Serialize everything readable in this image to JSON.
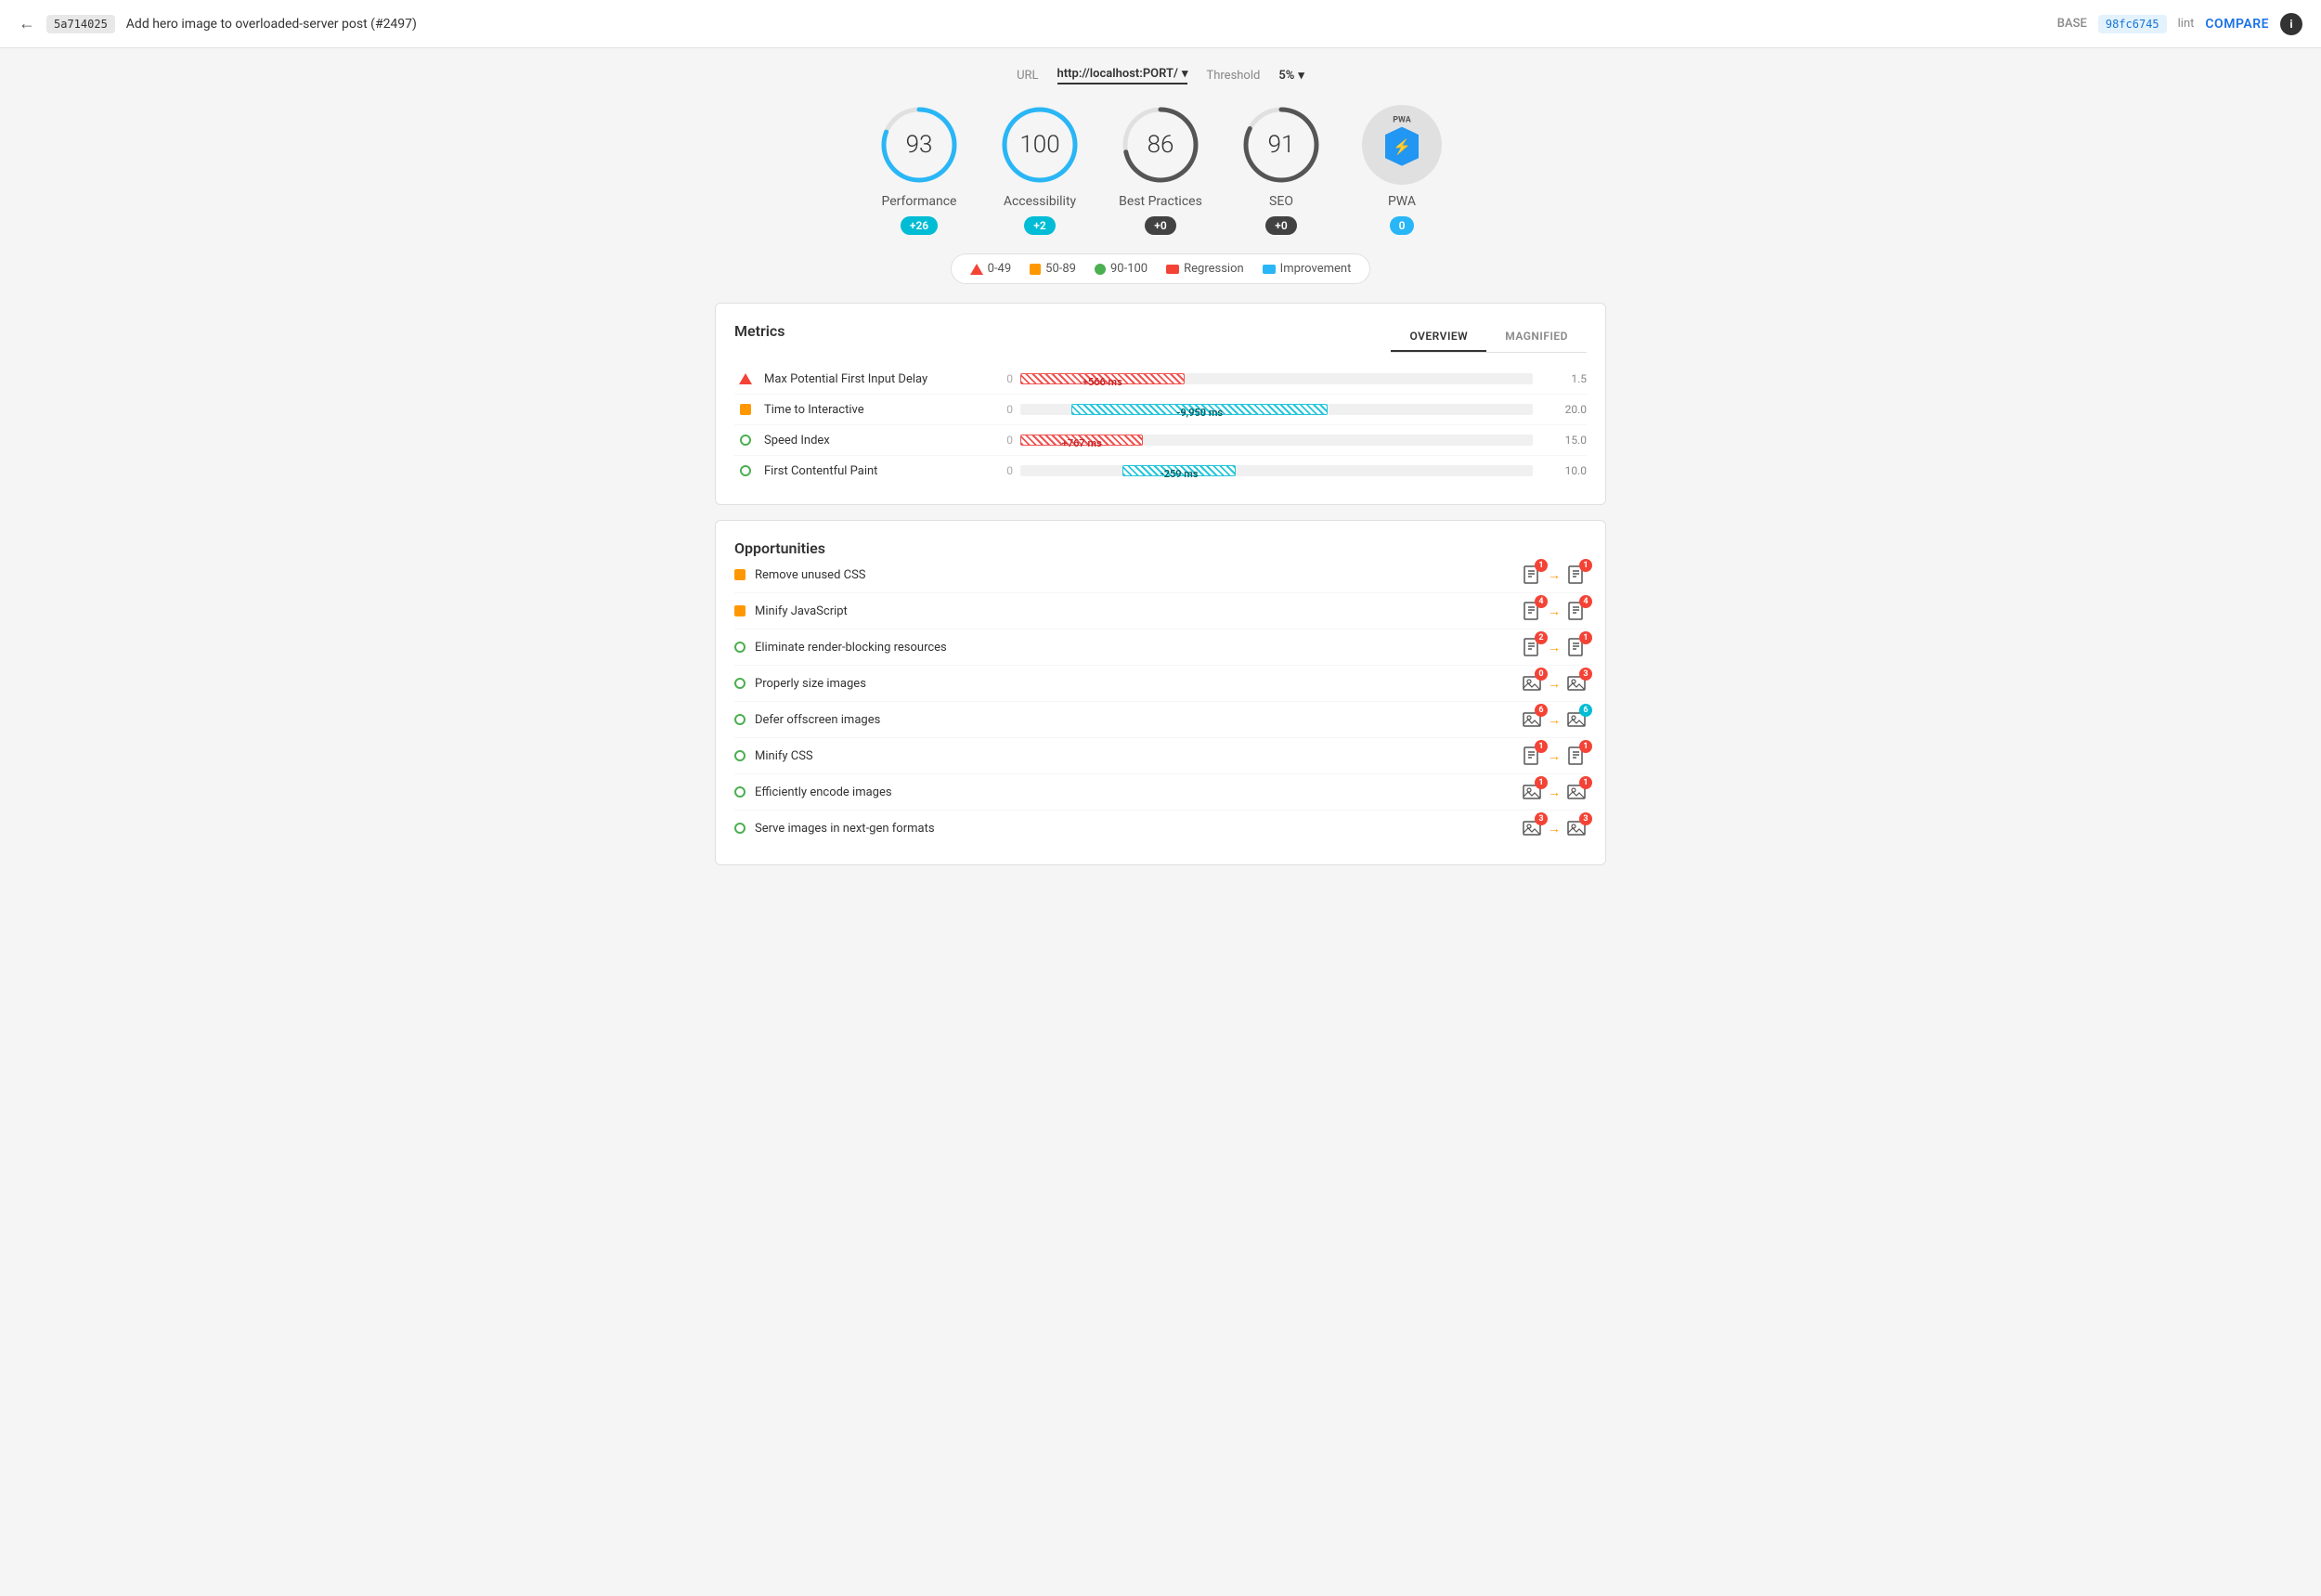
{
  "header": {
    "back_label": "←",
    "commit_base": "5a714025",
    "commit_title": "Add hero image to overloaded-server post (#2497)",
    "base_label": "BASE",
    "commit_compare": "98fc6745",
    "lint_label": "lint",
    "compare_label": "COMPARE",
    "info_label": "i"
  },
  "url_bar": {
    "url_label": "URL",
    "url_value": "http://localhost:PORT/",
    "threshold_label": "Threshold",
    "threshold_value": "5%"
  },
  "scores": [
    {
      "id": "performance",
      "value": "93",
      "label": "Performance",
      "badge": "+26",
      "badge_type": "teal",
      "color": "#29b6f6",
      "track_color": "#333"
    },
    {
      "id": "accessibility",
      "value": "100",
      "label": "Accessibility",
      "badge": "+2",
      "badge_type": "teal",
      "color": "#29b6f6",
      "track_color": "#333"
    },
    {
      "id": "best-practices",
      "value": "86",
      "label": "Best Practices",
      "badge": "+0",
      "badge_type": "dark",
      "color": "#333",
      "track_color": "#333"
    },
    {
      "id": "seo",
      "value": "91",
      "label": "SEO",
      "badge": "+0",
      "badge_type": "dark",
      "color": "#333",
      "track_color": "#333"
    },
    {
      "id": "pwa",
      "value": "PWA",
      "label": "PWA",
      "badge": "0",
      "badge_type": "blue",
      "is_pwa": true
    }
  ],
  "legend": [
    {
      "type": "triangle",
      "label": "0-49"
    },
    {
      "type": "square",
      "label": "50-89"
    },
    {
      "type": "circle",
      "label": "90-100"
    },
    {
      "type": "rect-red",
      "label": "Regression"
    },
    {
      "type": "rect-blue",
      "label": "Improvement"
    }
  ],
  "metrics": {
    "title": "Metrics",
    "tabs": [
      "OVERVIEW",
      "MAGNIFIED"
    ],
    "active_tab": 0,
    "rows": [
      {
        "icon": "triangle",
        "name": "Max Potential First Input Delay",
        "zero": "0",
        "bar_type": "positive-red",
        "bar_width_pct": 30,
        "bar_label": "+566 ms",
        "score": "1.5"
      },
      {
        "icon": "square",
        "name": "Time to Interactive",
        "zero": "0",
        "bar_type": "negative-teal",
        "bar_width_pct": 45,
        "bar_offset_pct": 15,
        "bar_label": "-9,950 ms",
        "score": "20.0"
      },
      {
        "icon": "circle-green",
        "name": "Speed Index",
        "zero": "0",
        "bar_type": "positive-red",
        "bar_width_pct": 20,
        "bar_label": "+767 ms",
        "score": "15.0"
      },
      {
        "icon": "circle-green",
        "name": "First Contentful Paint",
        "zero": "0",
        "bar_type": "negative-teal",
        "bar_width_pct": 18,
        "bar_offset_pct": 18,
        "bar_label": "-259 ms",
        "score": "10.0"
      }
    ]
  },
  "opportunities": {
    "title": "Opportunities",
    "rows": [
      {
        "icon": "square",
        "name": "Remove unused CSS",
        "base_badge": "1",
        "arrow": "→",
        "compare_badge": "1",
        "compare_color": "red"
      },
      {
        "icon": "square",
        "name": "Minify JavaScript",
        "base_badge": "4",
        "arrow": "→",
        "compare_badge": "4",
        "compare_color": "red"
      },
      {
        "icon": "circle-green",
        "name": "Eliminate render-blocking resources",
        "base_badge": "2",
        "arrow": "→",
        "compare_badge": "1",
        "compare_color": "red"
      },
      {
        "icon": "circle-green",
        "name": "Properly size images",
        "base_badge": "0",
        "arrow": "→",
        "compare_badge": "3",
        "compare_color": "red",
        "img_icon": true
      },
      {
        "icon": "circle-green",
        "name": "Defer offscreen images",
        "base_badge": "6",
        "arrow": "→",
        "compare_badge": "6",
        "compare_color": "teal",
        "img_icon": true
      },
      {
        "icon": "circle-green",
        "name": "Minify CSS",
        "base_badge": "1",
        "arrow": "→",
        "compare_badge": "1",
        "compare_color": "red"
      },
      {
        "icon": "circle-green",
        "name": "Efficiently encode images",
        "base_badge": "1",
        "arrow": "→",
        "compare_badge": "1",
        "compare_color": "red",
        "img_icon": true
      },
      {
        "icon": "circle-green",
        "name": "Serve images in next-gen formats",
        "base_badge": "3",
        "arrow": "→",
        "compare_badge": "3",
        "compare_color": "red",
        "img_icon": true
      }
    ]
  }
}
